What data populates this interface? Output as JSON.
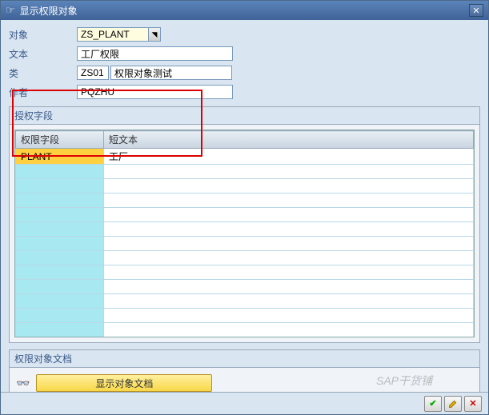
{
  "window": {
    "title": "显示权限对象"
  },
  "form": {
    "object_label": "对象",
    "object_value": "ZS_PLANT",
    "text_label": "文本",
    "text_value": "工厂权限",
    "class_label": "类",
    "class_code": "ZS01",
    "class_desc": "权限对象测试",
    "author_label": "作者",
    "author_value": "PQZHU"
  },
  "auth_fields": {
    "group_title": "授权字段",
    "col_field": "权限字段",
    "col_text": "短文本",
    "rows": [
      {
        "field": "PLANT",
        "text": "工厂"
      }
    ]
  },
  "doc": {
    "group_title": "权限对象文档",
    "button_label": "显示对象文档"
  },
  "watermark": "SAP干货铺"
}
